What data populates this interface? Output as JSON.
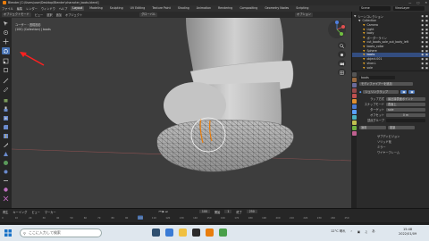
{
  "window": {
    "title": "Blender [C:\\Users\\user\\Desktop\\Blender\\character_boots.blend]"
  },
  "menu": {
    "items": [
      "ファイル",
      "編集",
      "レンダー",
      "ウィンドウ",
      "ヘルプ"
    ],
    "tabs": [
      "Layout",
      "Modeling",
      "Sculpting",
      "UV Editing",
      "Texture Paint",
      "Shading",
      "Animation",
      "Rendering",
      "Compositing",
      "Geometry Nodes",
      "Scripting"
    ],
    "active_tab": "Layout",
    "scene": "Scene",
    "view_layer": "ViewLayer"
  },
  "header": {
    "mode": "オブジェクトモード",
    "view": "ビュー",
    "select": "選択",
    "add": "追加",
    "object": "オブジェクト",
    "transform": "グローバル",
    "options": "オプション"
  },
  "viewport": {
    "info_line1": "ユーザー・透視投影",
    "info_line2": "(100) (Collection) | boots"
  },
  "outliner": {
    "title": "シーンコレクション",
    "rows": [
      {
        "label": "シーンコレクション",
        "indent": 0,
        "color": "#bbbbbb",
        "selected": false
      },
      {
        "label": "Collection",
        "indent": 1,
        "color": "#bbbbbb",
        "selected": false
      },
      {
        "label": "Camera",
        "indent": 2,
        "color": "#e0a020",
        "selected": false
      },
      {
        "label": "Light",
        "indent": 2,
        "color": "#e0a020",
        "selected": false
      },
      {
        "label": "body",
        "indent": 2,
        "color": "#e0a020",
        "selected": false
      },
      {
        "label": "ボーダーライン",
        "indent": 2,
        "color": "#e0a020",
        "selected": false
      },
      {
        "label": "cut_boots_sole_out_body_left",
        "indent": 2,
        "color": "#e0a020",
        "selected": false
      },
      {
        "label": "boots_collar",
        "indent": 2,
        "color": "#e0a020",
        "selected": false
      },
      {
        "label": "Sphere",
        "indent": 2,
        "color": "#e0a020",
        "selected": false
      },
      {
        "label": "boots",
        "indent": 2,
        "color": "#e0a020",
        "selected": true
      },
      {
        "label": "object.001",
        "indent": 2,
        "color": "#e0a020",
        "selected": false
      },
      {
        "label": "shoe.L",
        "indent": 2,
        "color": "#e0a020",
        "selected": false
      },
      {
        "label": "sole",
        "indent": 2,
        "color": "#e0a020",
        "selected": false
      }
    ]
  },
  "properties": {
    "object_name": "boots",
    "modifier_add": "モディファイアーを追加",
    "modifier_name": "シュリンクラップ",
    "wrap_method_label": "ラップ方式",
    "wrap_method": "最近接表面ポイント",
    "snap_mode_label": "スナップモード",
    "snap_mode": "表面上",
    "target_label": "ターゲット",
    "target": "sole",
    "offset_label": "オフセット",
    "offset": "0 m",
    "vertex_group_label": "頂点グループ",
    "apply_label": "適用",
    "dup_label": "複製",
    "extra_items": [
      "サブディビジョン",
      "ソリッド化",
      "ミラー",
      "ワイヤーフレーム"
    ]
  },
  "timeline": {
    "labels": [
      "再生",
      "キーイング",
      "ビュー",
      "マーカー"
    ],
    "frame": "100",
    "start_label": "開始",
    "start": "1",
    "end_label": "終了",
    "end": "250",
    "ruler": [
      "0",
      "10",
      "20",
      "30",
      "40",
      "50",
      "60",
      "70",
      "80",
      "90",
      "100",
      "110",
      "120",
      "130",
      "140",
      "150",
      "160",
      "170",
      "180",
      "190",
      "200",
      "210",
      "220",
      "230",
      "240",
      "250"
    ]
  },
  "taskbar": {
    "search_placeholder": "ここに入力して検索",
    "weather": "12°C 晴れ",
    "ime": "あ",
    "time": "15:48",
    "date": "2022/01/09"
  },
  "colors": {
    "accent": "#4772b3",
    "outline_selected": "#e87d0d",
    "annotation_arrow": "#ff2020"
  }
}
